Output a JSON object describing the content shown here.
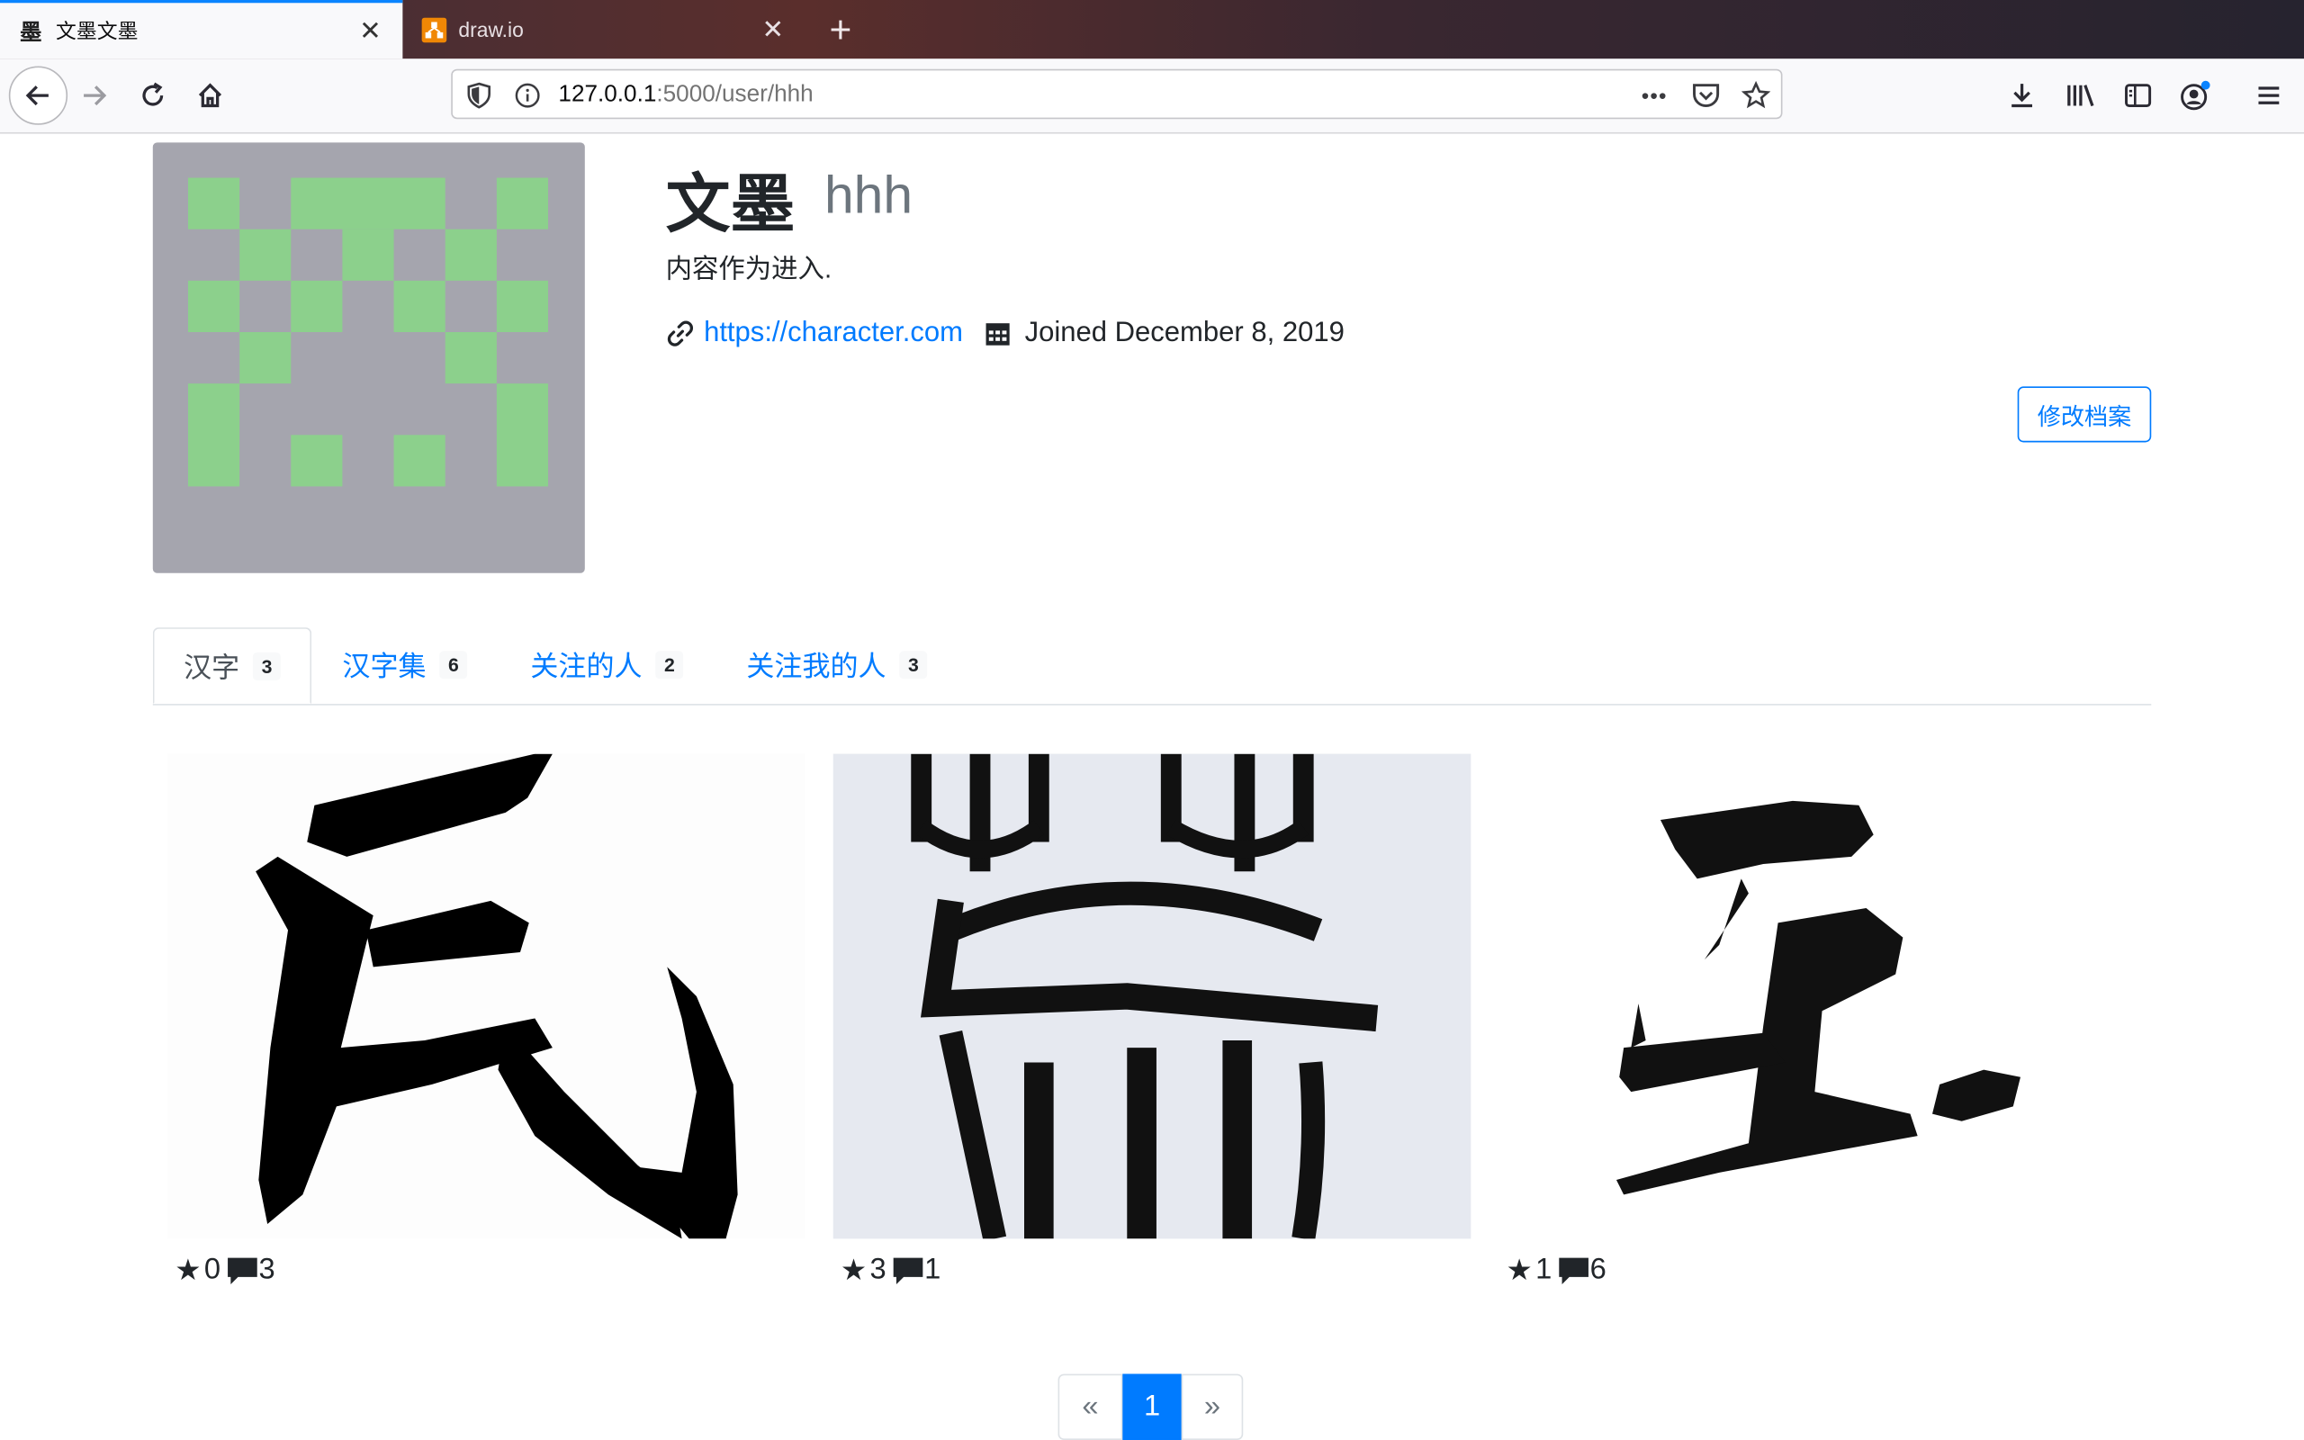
{
  "browser": {
    "tabs": [
      {
        "title": "文墨文墨",
        "favicon": "墨"
      },
      {
        "title": "draw.io",
        "favicon": "drawio-icon"
      }
    ],
    "new_tab": "+",
    "url_host": "127.0.0.1",
    "url_rest": ":5000/user/hhh",
    "more": "•••"
  },
  "profile": {
    "name": "文墨",
    "username": "hhh",
    "bio": "内容作为进入.",
    "website": "https://character.com",
    "joined": "Joined December 8, 2019",
    "edit_label": "修改档案"
  },
  "tabs": [
    {
      "label": "汉字",
      "count": "3"
    },
    {
      "label": "汉字集",
      "count": "6"
    },
    {
      "label": "关注的人",
      "count": "2"
    },
    {
      "label": "关注我的人",
      "count": "3"
    }
  ],
  "characters": [
    {
      "stars": "0",
      "comments": "3"
    },
    {
      "stars": "3",
      "comments": "1"
    },
    {
      "stars": "1",
      "comments": "6"
    }
  ],
  "pagination": {
    "prev": "«",
    "current": "1",
    "next": "»"
  },
  "colors": {
    "accent": "#007bff",
    "avatar_bg": "#a5a5ae",
    "avatar_cell": "#8cd08c"
  }
}
